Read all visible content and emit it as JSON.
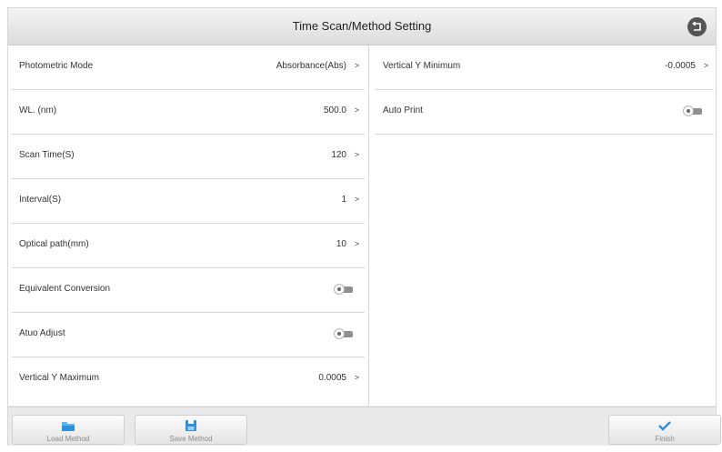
{
  "header": {
    "title": "Time Scan/Method Setting",
    "back_icon": "back-icon"
  },
  "left_settings": [
    {
      "label": "Photometric Mode",
      "value": "Absorbance(Abs)",
      "chevron": ">"
    },
    {
      "label": "WL.  (nm)",
      "value": "500.0",
      "chevron": ">"
    },
    {
      "label": "Scan Time(S)",
      "value": "120",
      "chevron": ">"
    },
    {
      "label": "Interval(S)",
      "value": "1",
      "chevron": ">"
    },
    {
      "label": "Optical path(mm)",
      "value": "10",
      "chevron": ">"
    },
    {
      "label": "Equivalent Conversion",
      "toggle": "off"
    },
    {
      "label": "Atuo Adjust",
      "toggle": "off"
    },
    {
      "label": "Vertical Y Maximum",
      "value": "0.0005",
      "chevron": ">"
    }
  ],
  "right_settings": [
    {
      "label": "Vertical Y Minimum",
      "value": "-0.0005",
      "chevron": ">"
    },
    {
      "label": "Auto Print",
      "toggle": "off"
    }
  ],
  "footer": {
    "load_method": "Load Method",
    "save_method": "Save Method",
    "finish": "Finish"
  },
  "colors": {
    "accent_blue": "#2f8fd8",
    "icon_dark": "#555555"
  }
}
